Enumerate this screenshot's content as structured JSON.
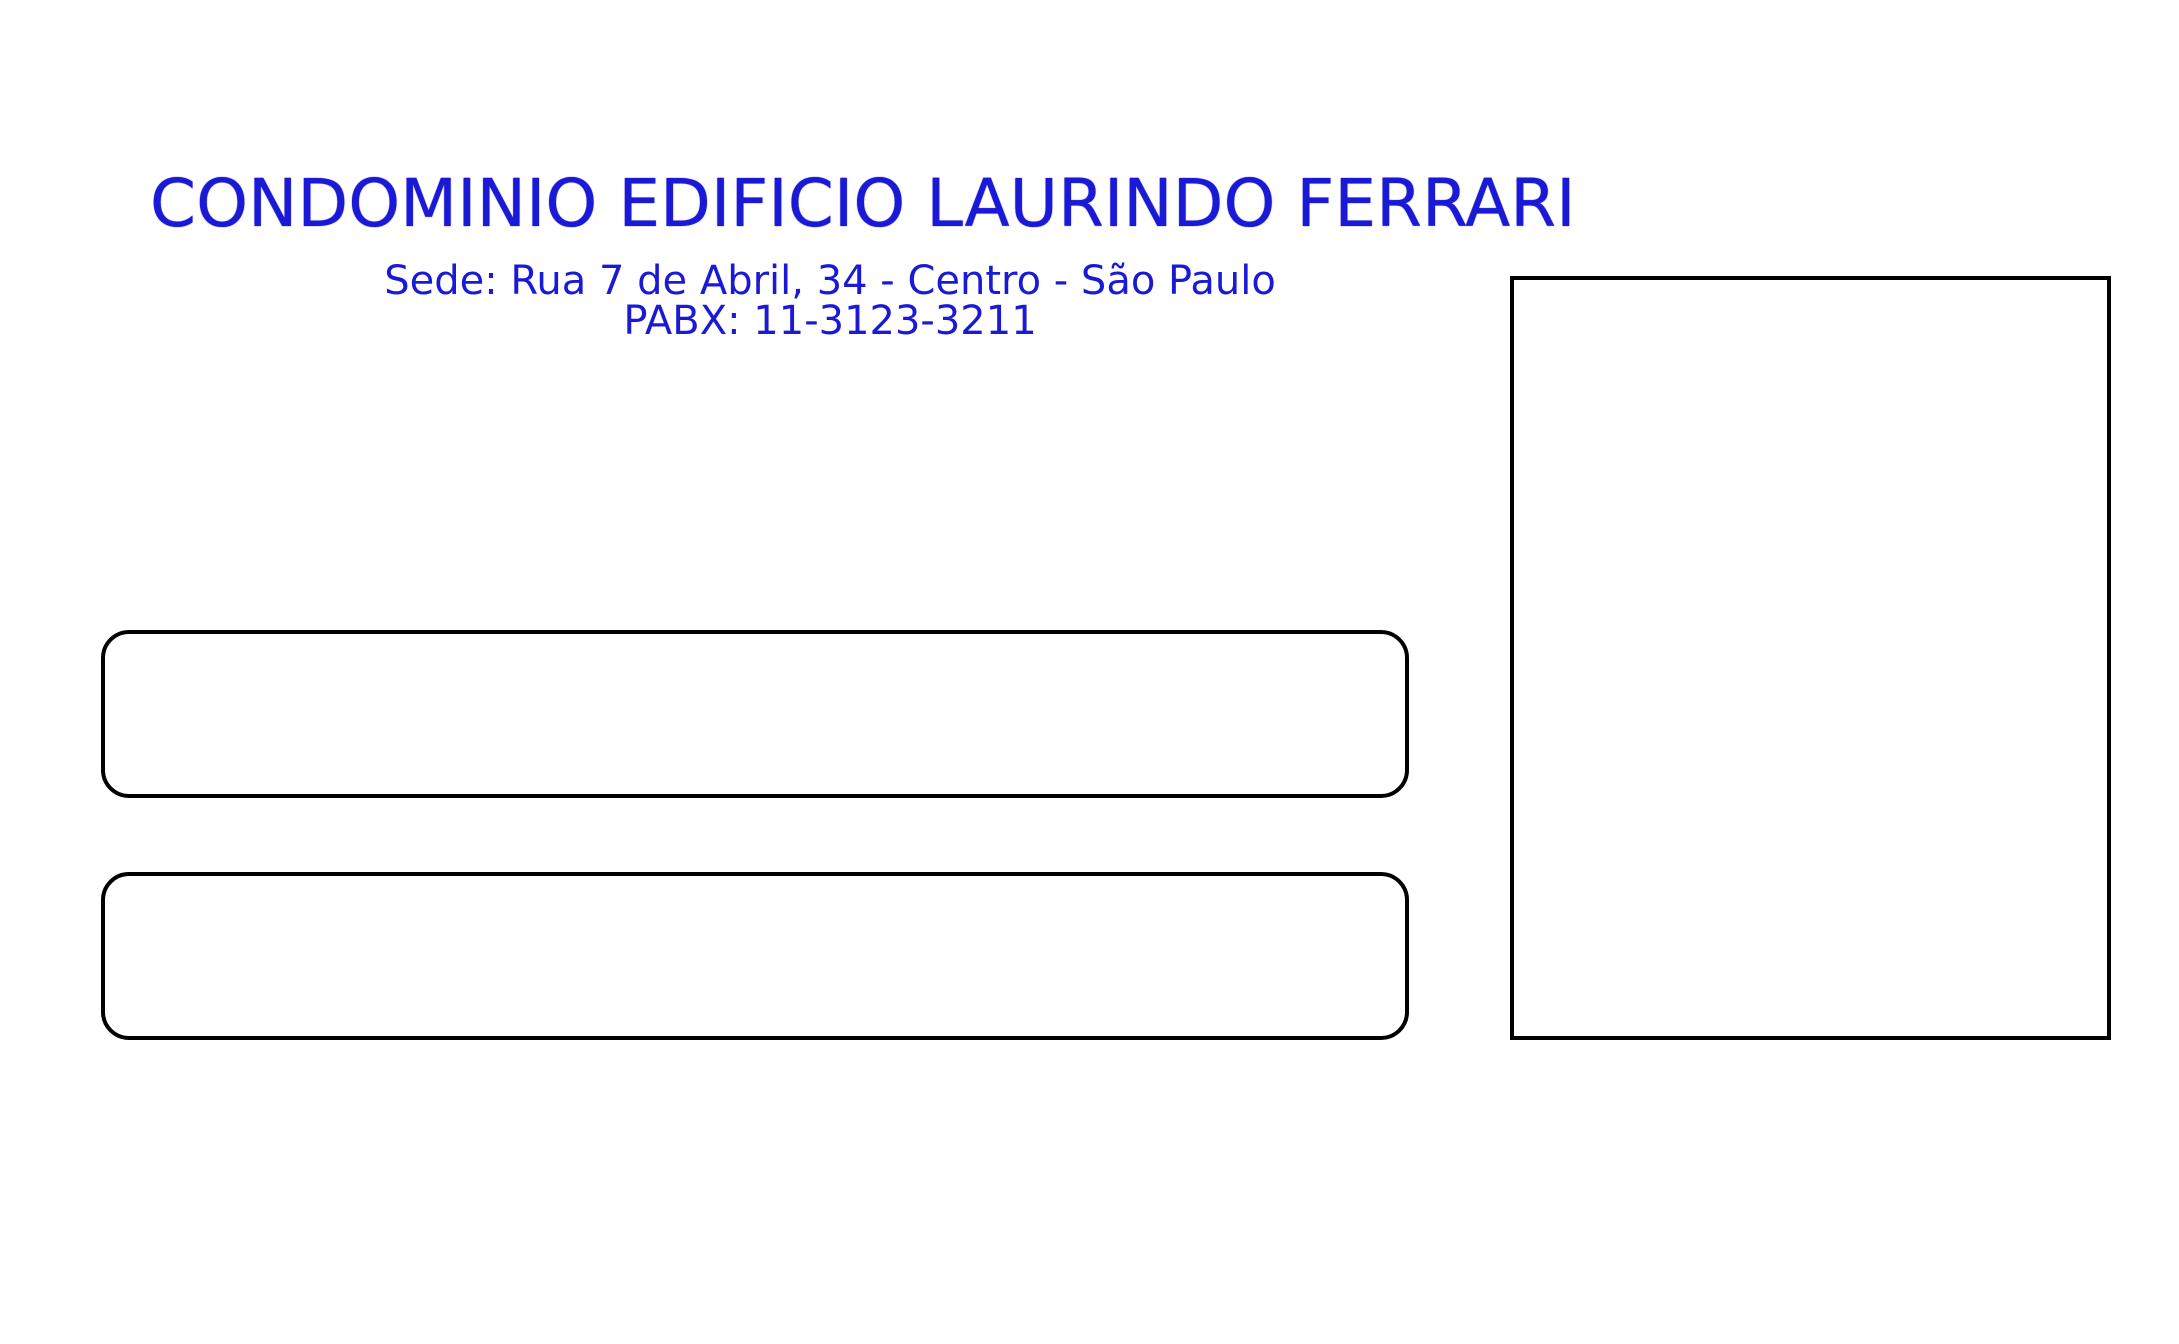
{
  "header": {
    "title": "CONDOMINIO EDIFICIO LAURINDO FERRARI",
    "address": "Sede: Rua 7 de Abril, 34 - Centro - São Paulo",
    "phone": "PABX: 11-3123-3211"
  },
  "colors": {
    "text": "#1a1ad6",
    "border": "#000000",
    "background": "#ffffff"
  }
}
